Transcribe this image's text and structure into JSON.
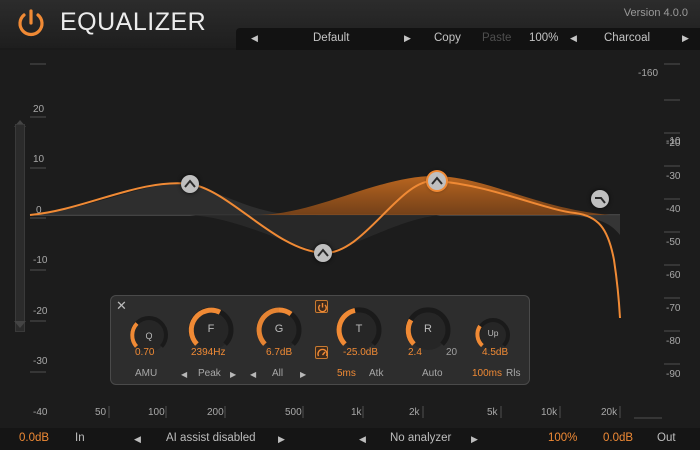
{
  "header": {
    "title": "EQUALIZER",
    "version": "Version 4.0.0",
    "logo_icon": "power-icon",
    "accent_color": "#f08a35"
  },
  "preset_bar": {
    "preset": "Default",
    "copy": "Copy",
    "paste": "Paste",
    "zoom": "100%",
    "theme": "Charcoal"
  },
  "graph": {
    "left_scale": [
      "20",
      "10",
      "0",
      "-10",
      "-20",
      "-30",
      "-40"
    ],
    "right_scale": [
      "-160",
      "-10",
      "-20",
      "-30",
      "-40",
      "-50",
      "-60",
      "-70",
      "-80",
      "-90"
    ],
    "freq_labels": [
      "50",
      "100",
      "200",
      "500",
      "1k",
      "2k",
      "5k",
      "10k",
      "20k"
    ]
  },
  "band_panel": {
    "q": {
      "letter": "Q",
      "value": "0.70",
      "label": "AMU"
    },
    "freq": {
      "letter": "F",
      "value": "2394Hz",
      "mode": "Peak"
    },
    "gain": {
      "letter": "G",
      "value": "6.7dB",
      "channel": "All"
    },
    "threshold": {
      "letter": "T",
      "value": "-25.0dB",
      "attack": "5ms",
      "attack_label": "Atk"
    },
    "ratio": {
      "letter": "R",
      "value": "2.4",
      "max": "20",
      "mode": "Auto"
    },
    "up": {
      "letter": "Up",
      "value": "4.5dB",
      "release": "100ms",
      "release_label": "Rls"
    }
  },
  "footer": {
    "input_gain": "0.0dB",
    "in_label": "In",
    "ai_assist": "AI assist disabled",
    "analyzer": "No analyzer",
    "mix": "100%",
    "output_gain": "0.0dB",
    "out_label": "Out"
  }
}
